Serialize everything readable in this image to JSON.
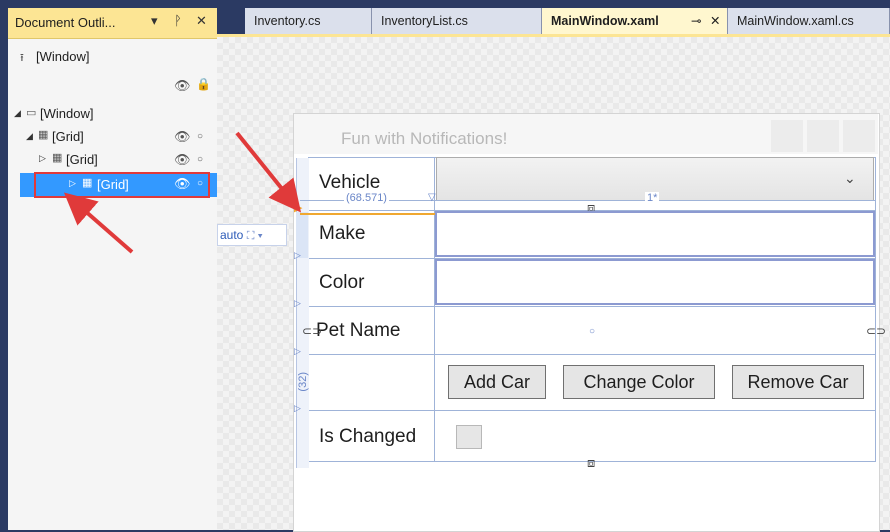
{
  "outline": {
    "title": "Document Outli...",
    "dropdown_glyph": "▾",
    "pin_glyph": "ᚹ",
    "close_glyph": "✕",
    "items": [
      {
        "label": "[Window]",
        "icon": "window-up-icon"
      },
      {
        "label": "[Window]",
        "icon": "window-icon"
      },
      {
        "label": "[Grid]",
        "icon": "grid-icon"
      },
      {
        "label": "[Grid]",
        "icon": "grid-icon"
      },
      {
        "label": "[Grid]",
        "icon": "grid-icon",
        "selected": true
      }
    ]
  },
  "tabs": [
    {
      "label": "Inventory.cs"
    },
    {
      "label": "InventoryList.cs"
    },
    {
      "label": "MainWindow.xaml",
      "active": true,
      "pin": "⊸",
      "close": "✕"
    },
    {
      "label": "MainWindow.xaml.cs"
    }
  ],
  "designer": {
    "window_title": "Fun with Notifications!",
    "rows": {
      "vehicle": "Vehicle",
      "make": "Make",
      "color": "Color",
      "pet_name": "Pet Name",
      "is_changed": "Is Changed"
    },
    "buttons": {
      "add_car": "Add Car",
      "change_color": "Change Color",
      "remove_car": "Remove Car"
    },
    "combo_arrow": "⌄",
    "adorners": {
      "column_width": "(68.571)",
      "star_width": "1*",
      "auto": "auto",
      "row_height": "(32)"
    }
  },
  "colors": {
    "outline_header": "#fce594",
    "selection": "#3399ff",
    "annotation_arrow": "#e03a3a",
    "active_tab": "#fff7cf",
    "panel_bg": "#2b3a63"
  }
}
